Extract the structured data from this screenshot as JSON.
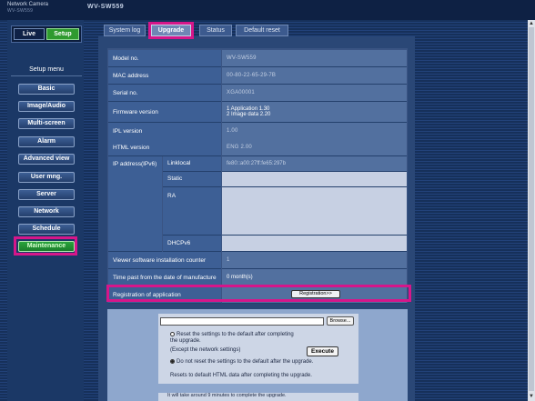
{
  "header": {
    "product_label": "Network Camera",
    "product_sub": "WV-SW559",
    "model": "WV-SW559"
  },
  "mode": {
    "live_label": "Live",
    "setup_label": "Setup"
  },
  "setup_menu": {
    "title": "Setup menu",
    "items": [
      {
        "label": "Basic"
      },
      {
        "label": "Image/Audio"
      },
      {
        "label": "Multi-screen"
      },
      {
        "label": "Alarm"
      },
      {
        "label": "Advanced view"
      },
      {
        "label": "User mng."
      },
      {
        "label": "Server"
      },
      {
        "label": "Network"
      },
      {
        "label": "Schedule"
      },
      {
        "label": "Maintenance",
        "active": true
      }
    ]
  },
  "tabs": [
    {
      "label": "System log"
    },
    {
      "label": "Upgrade",
      "active": true
    },
    {
      "label": "Status"
    },
    {
      "label": "Default reset"
    }
  ],
  "info": {
    "model_no_label": "Model no.",
    "model_no_value": "WV-SW559",
    "mac_label": "MAC address",
    "mac_value": "00-80-22-65-29-7B",
    "serial_label": "Serial no.",
    "serial_value": "XGA00001",
    "firmware_label": "Firmware version",
    "firmware_line1": "1 Application        1.30",
    "firmware_line2": "2 Image data         2.20",
    "ipl_label": "IPL version",
    "ipl_value": "1.00",
    "html_label": "HTML version",
    "html_value": "ENG 2.00",
    "ipv6_label": "IP address(IPv6)",
    "linklocal_label": "Linklocal",
    "linklocal_value": "fe80::a00:27ff:fe65:297b",
    "static_label": "Static",
    "ra_label": "RA",
    "dhcpv6_label": "DHCPv6",
    "viewer_label": "Viewer software installation counter",
    "viewer_value": "1",
    "time_label": "Time past from the date of manufacture",
    "time_value": "0 month(s)",
    "reg_label": "Registration of application",
    "reg_button": "Registration>>"
  },
  "upgrade": {
    "browse_label": "Browse...",
    "file_placeholder": "",
    "opt1_line1": "Reset the settings to the default after completing",
    "opt1_line2": "the upgrade.",
    "opt1_line3": "(Except the network settings)",
    "execute_label": "Execute",
    "opt2_label": "Do not reset the settings to the default after the upgrade.",
    "reset_note": "Resets to default HTML data after completing the upgrade.",
    "bottom_note": "It will take around 9 minutes to complete the upgrade."
  }
}
